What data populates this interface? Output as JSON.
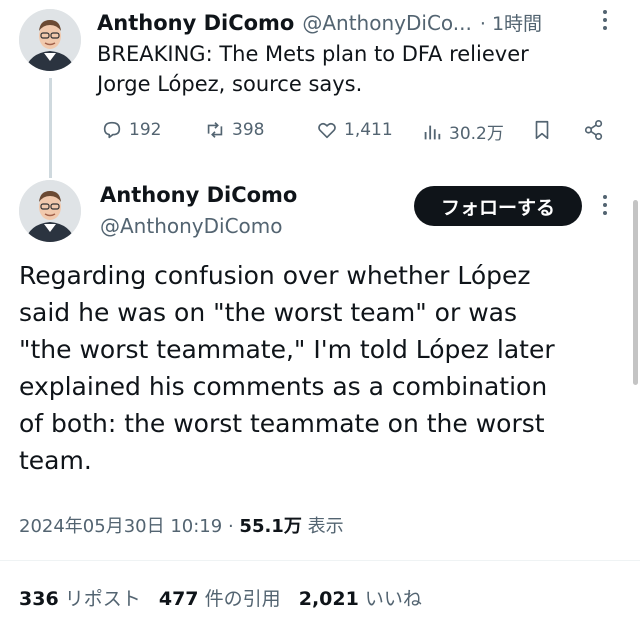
{
  "reply_tweet": {
    "name": "Anthony DiComo",
    "handle": "@AnthonyDiCo...",
    "time": "· 1時間",
    "text_line1": "BREAKING: The Mets plan to DFA reliever",
    "text_line2": "Jorge López, source says.",
    "actions": {
      "replies": "192",
      "reposts": "398",
      "likes": "1,411",
      "views": "30.2万"
    }
  },
  "main_tweet": {
    "name": "Anthony DiComo",
    "handle": "@AnthonyDiComo",
    "follow_label": "フォローする",
    "text_lines": [
      "Regarding confusion over whether López",
      "said he was on \"the worst team\" or was",
      "\"the worst teammate,\" I'm told López later",
      "explained his comments as a combination",
      "of both: the worst teammate on the worst",
      "team."
    ],
    "timestamp": "2024年05月30日 10:19",
    "dot": "·",
    "views_count": "55.1万",
    "views_label": "表示"
  },
  "stats": {
    "reposts_count": "336",
    "reposts_label": "リポスト",
    "quotes_count": "477",
    "quotes_label": "件の引用",
    "likes_count": "2,021",
    "likes_label": "いいね"
  },
  "icons": [
    "avatar",
    "more-icon",
    "reply-icon",
    "repost-icon",
    "like-icon",
    "views-icon",
    "bookmark-icon",
    "share-icon"
  ],
  "colors": {
    "text": "#0f1419",
    "secondary": "#536471",
    "button": "#0f1419",
    "divider": "#eff3f4"
  }
}
